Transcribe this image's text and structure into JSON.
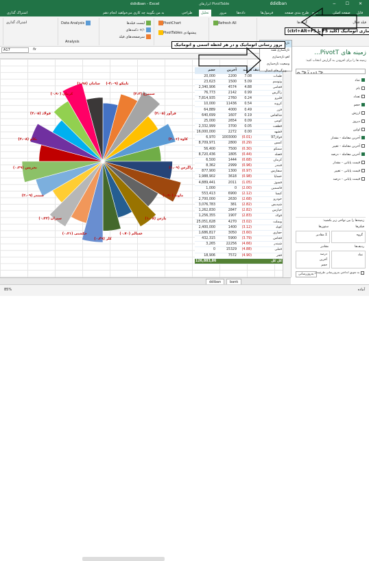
{
  "app": {
    "title": "ddidban - Excel",
    "context_title": "ابزارهای PivotTable",
    "quick_access": "ddidban",
    "window_controls": "− ☐ ✕"
  },
  "tabs": [
    "فایل",
    "صفحه اصلی",
    "درج",
    "طرح بندی صفحه",
    "فرمول‌ها",
    "داده‌ها",
    "مرور",
    "نما",
    "تحلیل",
    "طراحی",
    "به من بگویید چه کاری می‌خواهید انجام دهم",
    "اشتراک گذاری"
  ],
  "active_tab": "تحلیل",
  "ribbon": {
    "analyze_group": "Data Analysis",
    "analysis_label": "Analysis",
    "items": [
      "لیست فیلدها",
      "دکمه‌های +/-",
      "سرصفحه‌های فیلد",
      "PivotChart",
      "PivotTables پیشنهادی",
      "Refresh All",
      "گزینه‌ها",
      "فیلد فعال"
    ]
  },
  "dropdown": {
    "items": [
      "تازه‌سازی",
      "تازه‌سازی همه",
      "لغو تازه‌سازی",
      "وضعیت تازه‌سازی",
      "ویژگی‌های اتصال..."
    ]
  },
  "callouts": {
    "top": "تازه سازی اتوماتیک (کلید F5 یا ctrl+Alt+F5)",
    "second": "بروز رسانی اتوماتیک و در هر لحظه اسمی و اتوماتیک"
  },
  "formula_bar": {
    "name_box": "A17",
    "fx": "fx"
  },
  "pivot": {
    "headers": [
      "حجم",
      "آخرین",
      "درصد",
      "برچسب‌های ردیف"
    ],
    "filter_label": "فارس",
    "rows": [
      [
        "20,000",
        "2200",
        "7.08",
        "ظمات"
      ],
      [
        "23,623",
        "1500",
        "5.09",
        "وتوسم"
      ],
      [
        "2,340,906",
        "4574",
        "4.88",
        "قجامی"
      ],
      [
        "76,773",
        "2142",
        "0.99",
        "زاگرس"
      ],
      [
        "7,814,935",
        "2760",
        "0.24",
        "قلیرو"
      ],
      [
        "10,000",
        "11436",
        "0.54",
        "کروبه"
      ],
      [
        "64,889",
        "4000",
        "0.49",
        "فزر"
      ],
      [
        "640,699",
        "1607",
        "0.19",
        "شالفاس"
      ],
      [
        "25,000",
        "2654",
        "0.09",
        "کومی"
      ],
      [
        "2,332,999",
        "3700",
        "0.05",
        "قطعت"
      ],
      [
        "16,000,000",
        "2272",
        "0.00",
        "قشهد"
      ],
      [
        "6,970",
        "1003000",
        "(0.01)",
        "فولاژ97"
      ],
      [
        "8,709,971",
        "2800",
        "(0.29)",
        "کمس"
      ],
      [
        "56,400",
        "7500",
        "(0.30)",
        "سمکو"
      ],
      [
        "8,720,436",
        "1805",
        "(0.44)",
        "فصلد"
      ],
      [
        "6,500",
        "1444",
        "(0.68)",
        "کرمان"
      ],
      [
        "8,362",
        "2999",
        "(0.96)",
        "فبندر"
      ],
      [
        "877,900",
        "1300",
        "(0.97)",
        "سفارس"
      ],
      [
        "1,988,902",
        "3618",
        "(0.98)",
        "خساپا"
      ],
      [
        "4,889,441",
        "2011",
        "(1.05)",
        "فسوژ"
      ],
      [
        "1,000",
        "0",
        "(2.00)",
        "فاسمین"
      ],
      [
        "553,413",
        "6900",
        "(2.12)",
        "کیسا"
      ],
      [
        "2,700,000",
        "2630",
        "(2.68)",
        "خودرو"
      ],
      [
        "3,076,783",
        "381",
        "(2.82)",
        "شپدیس"
      ],
      [
        "1,262,830",
        "2847",
        "(2.82)",
        "خپارس"
      ],
      [
        "1,256,355",
        "1907",
        "(2.83)",
        "فولاد"
      ],
      [
        "25,051,628",
        "4270",
        "(3.02)",
        "وبملت"
      ],
      [
        "2,400,000",
        "1400",
        "(3.12)",
        "کچاد"
      ],
      [
        "1,686,817",
        "3050",
        "(3.60)",
        "حفاری"
      ],
      [
        "432,315",
        "5900",
        "(3.79)",
        "فخاس"
      ],
      [
        "3,265",
        "22256",
        "(4.66)",
        "شبندر"
      ],
      [
        "0",
        "15329",
        "(4.88)",
        "فملی"
      ],
      [
        "18,906",
        "7572",
        "(4.90)",
        "فجر"
      ]
    ],
    "total": [
      "126,883,865",
      "",
      "",
      "کل کل"
    ]
  },
  "pie_labels": [
    {
      "text": "تاپیکو (۲،۰۹-)"
    },
    {
      "text": "سیمرغ (۲،۳)"
    },
    {
      "text": "فرآور (۲،۰۵)"
    },
    {
      "text": "کاوه (۲،۰۶)"
    },
    {
      "text": "زاگرس (۱،۰۹)"
    },
    {
      "text": "ماوند (۰،۹۰)"
    },
    {
      "text": "پارس (۱،۰۸)"
    },
    {
      "text": "غسالم (۰،۷۰)"
    },
    {
      "text": "کلر (۰،۴۹)"
    },
    {
      "text": "حکشتی (۰،۲۱)"
    },
    {
      "text": "ستران (۰،۲۲)"
    },
    {
      "text": "شبندر (۲،۰۹)"
    },
    {
      "text": "نخریس (۰،۲۹)"
    },
    {
      "text": "بکام (۲،۰۸)"
    },
    {
      "text": "فولاد (۲،۰۵)"
    },
    {
      "text": "کرمان (۰،۹۰)"
    },
    {
      "text": "سامان (۱،۹۸)"
    }
  ],
  "pane": {
    "title": "زمینه های PivotT...",
    "subtitle": "زمینه ها را برای افزودن به گزارش انتخاب کنید:",
    "search_placeholder": "جستجو",
    "fields": [
      {
        "label": "نماد",
        "on": true
      },
      {
        "label": "نام",
        "on": false
      },
      {
        "label": "تعداد",
        "on": false
      },
      {
        "label": "حجم",
        "on": true
      },
      {
        "label": "ارزش",
        "on": false
      },
      {
        "label": "دیروز",
        "on": false
      },
      {
        "label": "اولین",
        "on": false
      },
      {
        "label": "آخرین معامله - مقدار",
        "on": true
      },
      {
        "label": "آخرین معامله - تغییر",
        "on": false
      },
      {
        "label": "آخرین معامله - درصد",
        "on": true
      },
      {
        "label": "قیمت پایانی - مقدار",
        "on": false
      },
      {
        "label": "قیمت پایانی - تغییر",
        "on": false
      },
      {
        "label": "قیمت پایانی - درصد",
        "on": false
      }
    ],
    "areas_label": "زمینه‌ها را بین نواحی زیر بکشید:",
    "filters_label": "فیلترها",
    "columns_label": "ستون‌ها",
    "columns_value": "Σ مقادیر",
    "filter_value": "گروه",
    "rows_label": "ردیف‌ها",
    "rows_value": "نماد",
    "values_label": "مقادیر",
    "values_items": [
      "درصد",
      "آخرین",
      "حجم"
    ],
    "defer": "به تعویق انداختن به‌روزرسانی طرح‌بندی",
    "update": "به‌روزرسانی"
  },
  "sheet_tabs": [
    "ddiban",
    "bank"
  ],
  "status": {
    "left": "آماده",
    "zoom": "85%"
  }
}
